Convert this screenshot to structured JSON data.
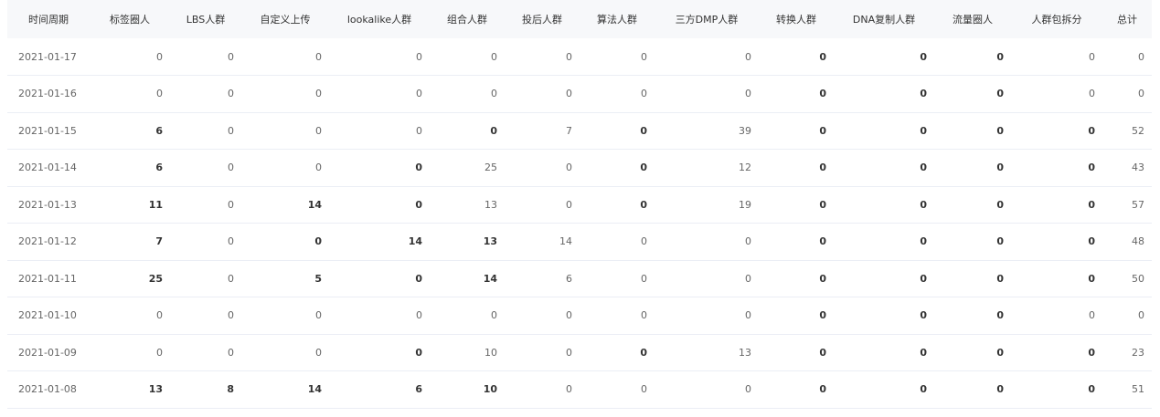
{
  "table": {
    "columns": [
      "时间周期",
      "标签圈人",
      "LBS人群",
      "自定义上传",
      "lookalike人群",
      "组合人群",
      "投后人群",
      "算法人群",
      "三方DMP人群",
      "转换人群",
      "DNA复制人群",
      "流量圈人",
      "人群包拆分",
      "总计"
    ],
    "rows": [
      [
        "2021-01-17",
        "0",
        "0",
        "0",
        "0",
        "0",
        "0",
        "0",
        "0",
        "0",
        "0",
        "0",
        "0",
        "0"
      ],
      [
        "2021-01-16",
        "0",
        "0",
        "0",
        "0",
        "0",
        "0",
        "0",
        "0",
        "0",
        "0",
        "0",
        "0",
        "0"
      ],
      [
        "2021-01-15",
        "6",
        "0",
        "0",
        "0",
        "0",
        "7",
        "0",
        "39",
        "0",
        "0",
        "0",
        "0",
        "52"
      ],
      [
        "2021-01-14",
        "6",
        "0",
        "0",
        "0",
        "25",
        "0",
        "0",
        "12",
        "0",
        "0",
        "0",
        "0",
        "43"
      ],
      [
        "2021-01-13",
        "11",
        "0",
        "14",
        "0",
        "13",
        "0",
        "0",
        "19",
        "0",
        "0",
        "0",
        "0",
        "57"
      ],
      [
        "2021-01-12",
        "7",
        "0",
        "0",
        "14",
        "13",
        "14",
        "0",
        "0",
        "0",
        "0",
        "0",
        "0",
        "48"
      ],
      [
        "2021-01-11",
        "25",
        "0",
        "5",
        "0",
        "14",
        "6",
        "0",
        "0",
        "0",
        "0",
        "0",
        "0",
        "50"
      ],
      [
        "2021-01-10",
        "0",
        "0",
        "0",
        "0",
        "0",
        "0",
        "0",
        "0",
        "0",
        "0",
        "0",
        "0",
        "0"
      ],
      [
        "2021-01-09",
        "0",
        "0",
        "0",
        "0",
        "10",
        "0",
        "0",
        "13",
        "0",
        "0",
        "0",
        "0",
        "23"
      ],
      [
        "2021-01-08",
        "13",
        "8",
        "14",
        "6",
        "10",
        "0",
        "0",
        "0",
        "0",
        "0",
        "0",
        "0",
        "51"
      ]
    ],
    "bold_cells": [
      [
        0,
        9
      ],
      [
        0,
        10
      ],
      [
        0,
        11
      ],
      [
        1,
        9
      ],
      [
        1,
        10
      ],
      [
        1,
        11
      ],
      [
        2,
        1
      ],
      [
        2,
        5
      ],
      [
        2,
        7
      ],
      [
        2,
        9
      ],
      [
        2,
        10
      ],
      [
        2,
        11
      ],
      [
        2,
        12
      ],
      [
        3,
        1
      ],
      [
        3,
        4
      ],
      [
        3,
        7
      ],
      [
        3,
        9
      ],
      [
        3,
        10
      ],
      [
        3,
        11
      ],
      [
        3,
        12
      ],
      [
        4,
        1
      ],
      [
        4,
        3
      ],
      [
        4,
        4
      ],
      [
        4,
        7
      ],
      [
        4,
        9
      ],
      [
        4,
        10
      ],
      [
        4,
        11
      ],
      [
        4,
        12
      ],
      [
        5,
        1
      ],
      [
        5,
        3
      ],
      [
        5,
        4
      ],
      [
        5,
        5
      ],
      [
        5,
        9
      ],
      [
        5,
        10
      ],
      [
        5,
        11
      ],
      [
        5,
        12
      ],
      [
        6,
        1
      ],
      [
        6,
        3
      ],
      [
        6,
        4
      ],
      [
        6,
        5
      ],
      [
        6,
        9
      ],
      [
        6,
        10
      ],
      [
        6,
        11
      ],
      [
        6,
        12
      ],
      [
        7,
        9
      ],
      [
        7,
        10
      ],
      [
        7,
        11
      ],
      [
        8,
        4
      ],
      [
        8,
        7
      ],
      [
        8,
        9
      ],
      [
        8,
        10
      ],
      [
        8,
        11
      ],
      [
        8,
        12
      ],
      [
        9,
        1
      ],
      [
        9,
        2
      ],
      [
        9,
        3
      ],
      [
        9,
        4
      ],
      [
        9,
        5
      ],
      [
        9,
        9
      ],
      [
        9,
        10
      ],
      [
        9,
        11
      ],
      [
        9,
        12
      ]
    ]
  }
}
